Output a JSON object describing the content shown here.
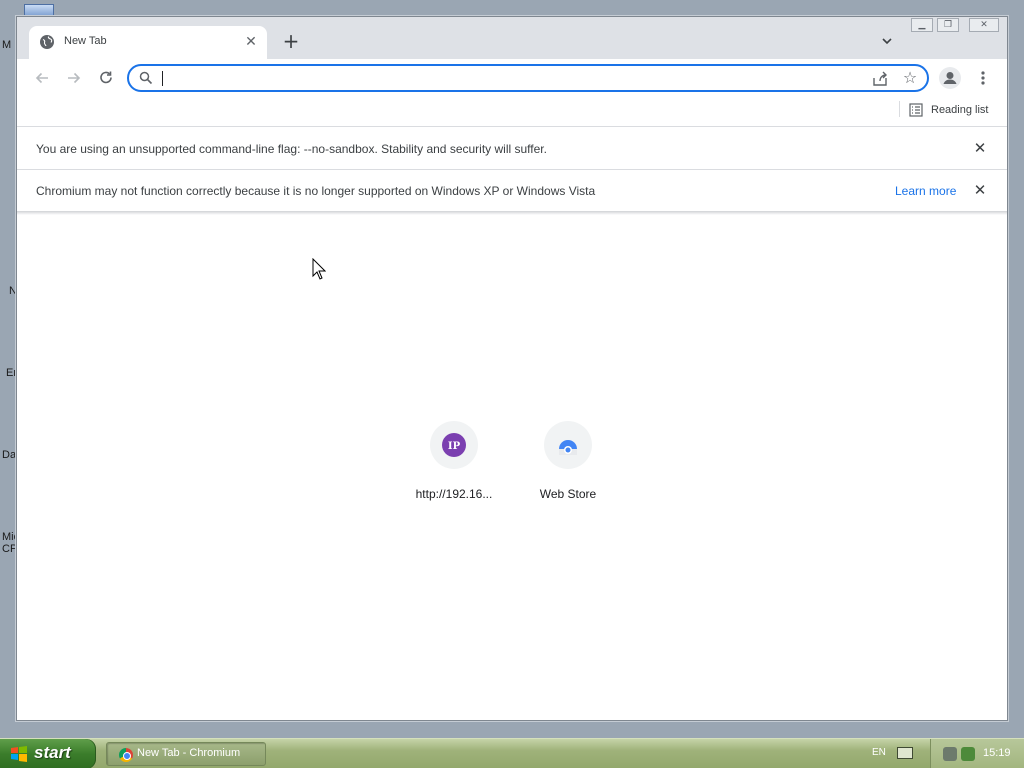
{
  "desktop": {
    "edge_labels": [
      "M",
      "N",
      "Er",
      "Da",
      "Mic",
      "CP"
    ]
  },
  "browser": {
    "tab": {
      "title": "New Tab",
      "favicon": "globe-icon",
      "close_icon": "close-icon"
    },
    "new_tab_icon": "plus-icon",
    "tab_search_icon": "chevron-down-icon",
    "window_controls": [
      "minimize-icon",
      "restore-icon",
      "close-icon"
    ],
    "toolbar": {
      "back_icon": "arrow-left-icon",
      "forward_icon": "arrow-right-icon",
      "reload_icon": "reload-icon",
      "omnibox": {
        "value": "",
        "placeholder": "",
        "search_icon": "search-icon"
      },
      "share_icon": "share-icon",
      "bookmark_icon": "star-icon",
      "profile_icon": "profile-icon",
      "menu_icon": "kebab-menu-icon"
    },
    "bookmarks_bar": {
      "reading_list_label": "Reading list",
      "reading_list_icon": "reading-list-icon"
    },
    "infobars": [
      {
        "text": "You are using an unsupported command-line flag: --no-sandbox. Stability and security will suffer.",
        "link": "",
        "close_icon": "close-icon"
      },
      {
        "text": "Chromium may not function correctly because it is no longer supported on Windows XP or Windows Vista",
        "link": "Learn more",
        "close_icon": "close-icon"
      }
    ],
    "ntp": {
      "shortcuts": [
        {
          "title": "http://192.16...",
          "icon": "ip-icon",
          "icon_letters": "IP",
          "icon_color": "#7b3fb0"
        },
        {
          "title": "Web Store",
          "icon": "web-store-icon",
          "icon_color": "#4285f4"
        }
      ]
    }
  },
  "taskbar": {
    "start_label": "start",
    "task_button_label": "New Tab - Chromium",
    "language": "EN",
    "clock": "15:19"
  },
  "colors": {
    "accent": "#1a73e8",
    "tab_strip": "#dee1e6",
    "taskbar": "#9fb27a",
    "start_button": "#3b7d2b"
  }
}
